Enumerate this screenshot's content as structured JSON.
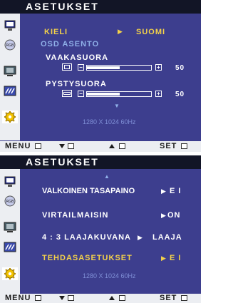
{
  "colors": {
    "panel_bg": "#3d3e8e",
    "title_bg": "#121526",
    "sidebar_bg": "#eceef2",
    "selected_text": "#f3d14a",
    "info_text": "#7f8fd6"
  },
  "menu1": {
    "title": "ASETUKSET",
    "kieli_label": "KIELI",
    "kieli_arrow": "▶",
    "kieli_value": "SUOMI",
    "osd_label": "OSD ASENTO",
    "vaaka_label": "VAAKASUORA",
    "vaaka_value": "50",
    "vaaka_level_percent": 50,
    "pysty_label": "PYSTYSUORA",
    "pysty_value": "50",
    "pysty_level_percent": 50,
    "minus": "−",
    "plus": "+",
    "down_arrow": "▼",
    "resolution": "1280 X 1024 60Hz",
    "bottom": {
      "menu": "MENU",
      "set": "SET"
    }
  },
  "menu2": {
    "title": "ASETUKSET",
    "up_arrow": "▲",
    "rows": [
      {
        "label": "VALKOINEN TASAPAINO",
        "arrow": "▶",
        "value": "E I"
      },
      {
        "label": "VIRTAILMAISIN",
        "arrow": "▶",
        "value": "ON"
      },
      {
        "label": "4 : 3 LAAJAKUVANA",
        "arrow": "▶",
        "value": "LAAJA"
      },
      {
        "label": "TEHDASASETUKSET",
        "arrow": "▶",
        "value": "E I"
      }
    ],
    "resolution": "1280 X 1024 60Hz",
    "bottom": {
      "menu": "MENU",
      "set": "SET"
    }
  },
  "icons": [
    "monitor-icon",
    "rgb-icon",
    "monitor-settings-icon",
    "tracking-icon",
    "gear-icon"
  ]
}
